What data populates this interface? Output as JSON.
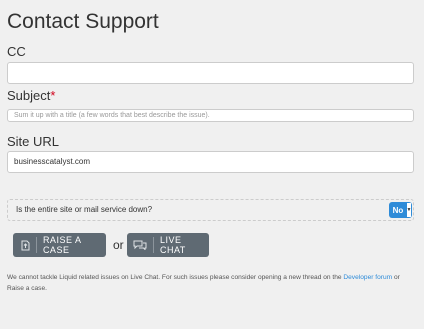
{
  "page": {
    "title": "Contact Support"
  },
  "form": {
    "cc": {
      "label": "CC",
      "value": ""
    },
    "subject": {
      "label": "Subject",
      "required_mark": "*",
      "placeholder": "Sum it up with a title (a few words that best describe the issue)."
    },
    "site_url": {
      "label": "Site URL",
      "value": "businesscatalyst.com"
    },
    "site_down": {
      "question": "Is the entire site or mail service down?",
      "selected": "No"
    }
  },
  "actions": {
    "raise_case": "RAISE A CASE",
    "or": "or",
    "live_chat": "LIVE CHAT"
  },
  "note": {
    "text_before": "We cannot tackle Liquid related issues on Live Chat. For such issues please consider opening a new thread on the ",
    "link": "Developer forum",
    "text_after": " or Raise a case."
  },
  "colors": {
    "accent": "#2e8bd8",
    "button": "#5f6a73",
    "required": "#d0021b"
  }
}
